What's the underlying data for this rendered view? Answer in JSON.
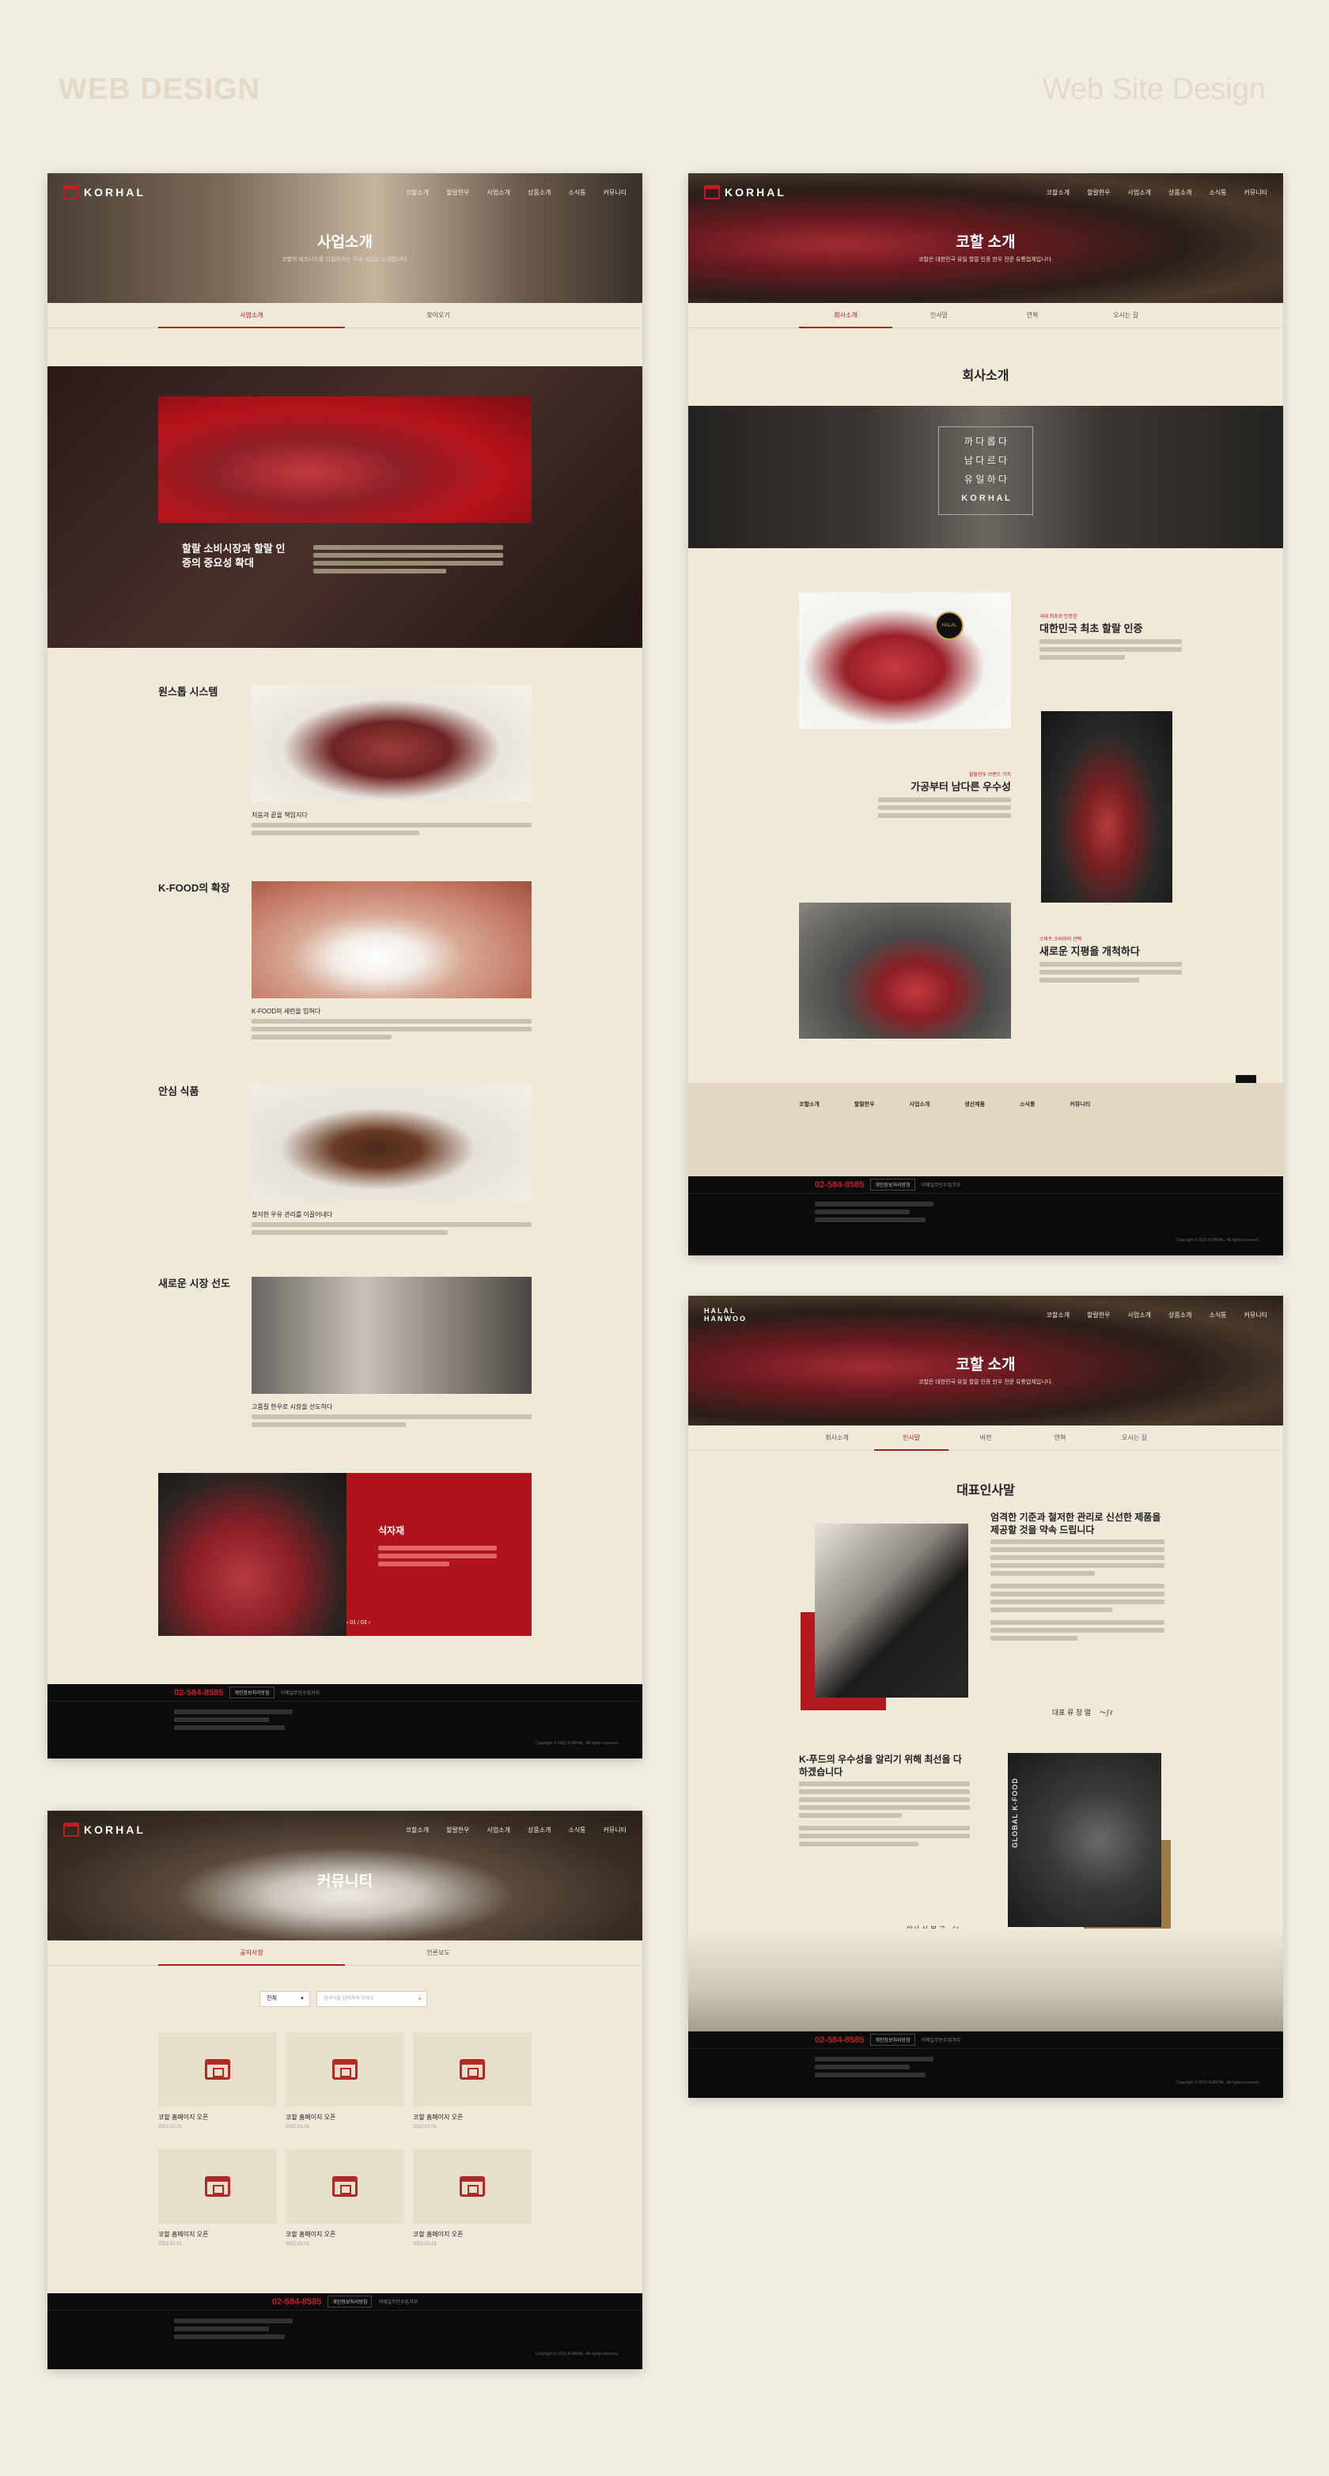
{
  "header": {
    "left": "WEB DESIGN",
    "right": "Web Site Design"
  },
  "nav": {
    "logo": "KORHAL",
    "items": [
      "코할소개",
      "할랄한우",
      "사업소개",
      "상품소개",
      "소식통",
      "커뮤니티"
    ]
  },
  "p1": {
    "title": "사업소개",
    "subtitle": "코할의 비즈니스를 이끌어가는 주요 사업을 소개합니다.",
    "tabs": [
      "사업소개",
      "찾아오기"
    ],
    "banner_title": "할랄 소비시장과 할랄 인증의 중요성 확대",
    "sections": [
      {
        "head": "원스톱 시스템",
        "caption": "처음과 끝을 책임지다"
      },
      {
        "head": "K-FOOD의 확장",
        "caption": "K-FOOD의 세련을 입혀다"
      },
      {
        "head": "안심 식품",
        "caption": "철저한 우유 관리를 이끌어내다"
      },
      {
        "head": "새로운 시장 선도",
        "caption": "고품질 한우로 시장을 선도하다"
      }
    ],
    "feature_title": "식자재",
    "pager": "01 / 03"
  },
  "p2": {
    "title": "코할 소개",
    "subtitle": "코할은 대한민국 유일 할랄 인증 한우 전문 유통업체입니다.",
    "tabs": [
      "회사소개",
      "인사말",
      "연혁",
      "오시는 길"
    ],
    "section_title": "회사소개",
    "slogan": [
      "까 다 롭 다",
      "남 다 르 다",
      "유 일 하 다",
      "K O R H A L"
    ],
    "halal_badge": "HALAL",
    "features": [
      {
        "tag": "국내 최초로 인증된",
        "title": "대한민국 최초 할랄 인증"
      },
      {
        "tag": "할랄한우 브랜드 가치",
        "title": "가공부터 남다른 우수성"
      },
      {
        "tag": "스마트 소비자의 선택",
        "title": "새로운 지평을 개척하다"
      }
    ],
    "sitemap": [
      "코할소개",
      "할랄한우",
      "사업소개",
      "생산제품",
      "소식통",
      "커뮤니티"
    ]
  },
  "p3": {
    "title": "커뮤니티",
    "subtitle": "코할의 소식을 알려드립니다",
    "tabs": [
      "공지사항",
      "언론보도"
    ],
    "select_label": "전체",
    "search_placeholder": "검색어를 입력하여 주세요",
    "cards": [
      {
        "title": "코할 홈페이지 오픈",
        "date": "2022.01.01"
      },
      {
        "title": "코할 홈페이지 오픈",
        "date": "2022.01.01"
      },
      {
        "title": "코할 홈페이지 오픈",
        "date": "2022.01.01"
      },
      {
        "title": "코할 홈페이지 오픈",
        "date": "2022.01.01"
      },
      {
        "title": "코할 홈페이지 오픈",
        "date": "2022.01.01"
      },
      {
        "title": "코할 홈페이지 오픈",
        "date": "2022.01.01"
      }
    ]
  },
  "p4": {
    "logo": "HALAL HANWOO",
    "title": "코할 소개",
    "subtitle": "코할은 대한민국 유일 할랄 인증 한우 전문 유통업체입니다.",
    "tabs": [
      "회사소개",
      "인사말",
      "비전",
      "연혁",
      "오시는 길"
    ],
    "section_title": "대표인사말",
    "headline": "엄격한 기준과 철저한 관리로 신선한 제품을 제공할 것을 약속 드립니다",
    "ceo_label": "대표 류 창 열",
    "k_head": "K-푸드의 우수성을 알리기 위해 최선을 다하겠습니다",
    "vp_label": "이사 신 봉 구",
    "globe_label": "GLOBAL K-FOOD"
  },
  "footer": {
    "tel": "02-584-8585",
    "btn1": "개인정보처리방침",
    "btn2": "이메일무단수집거부",
    "copy": "Copyright © 2022 KORHAL. All rights reserved."
  },
  "colors": {
    "accent": "#b21a1f",
    "bg": "#f1ede1",
    "footer": "#0b0b0b"
  }
}
